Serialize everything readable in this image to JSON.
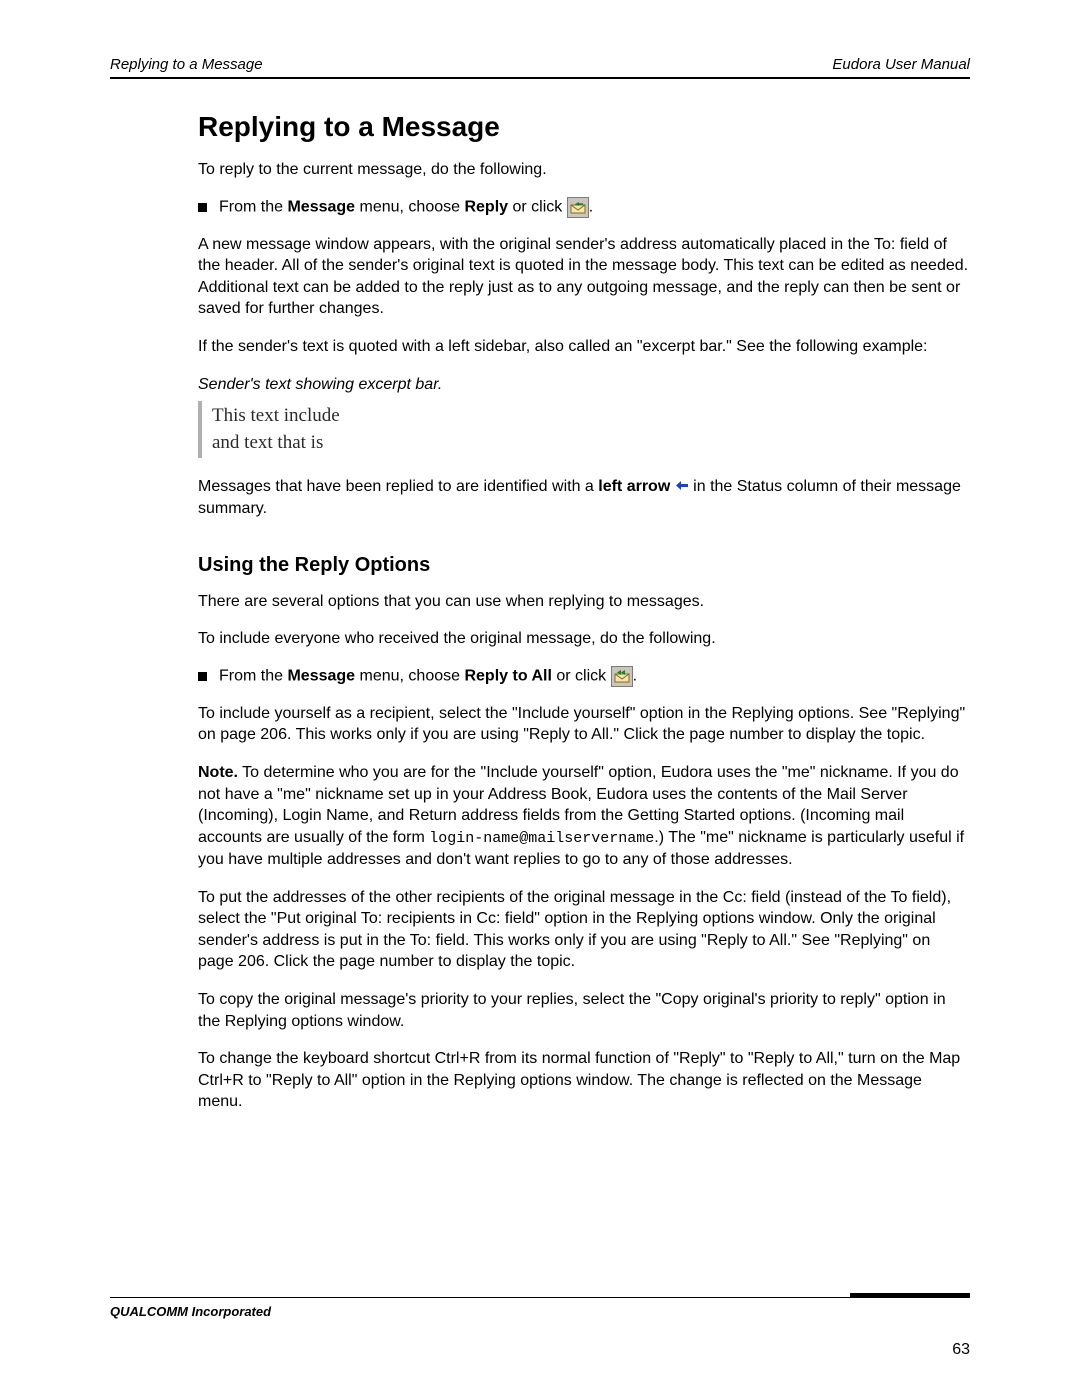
{
  "header": {
    "left": "Replying to a Message",
    "right": "Eudora User Manual"
  },
  "h1": "Replying to a Message",
  "p_intro": "To reply to the current message, do the following.",
  "bullet1": {
    "pre": "From the ",
    "bold1": "Message",
    "mid": " menu, choose ",
    "bold2": "Reply",
    "after": " or click ",
    "period": "."
  },
  "p2": "A new message window appears, with the original sender's address automatically placed in the To: field of the header. All of the sender's original text is quoted in the message body. This text can be edited as needed. Additional text can be added to the reply just as to any outgoing message, and the reply can then be sent or saved for further changes.",
  "p3": "If the sender's text is quoted with a left sidebar, also called an \"excerpt bar.\" See the following example:",
  "caption1": "Sender's text showing excerpt bar.",
  "excerpt": {
    "line1": "This text include",
    "line2": "and text that is"
  },
  "p4": {
    "pre": "Messages that have been replied to are identified with a ",
    "bold": "left arrow",
    "after": " in the Status column of their message summary."
  },
  "h2": "Using the Reply Options",
  "p5": "There are several options that you can use when replying to messages.",
  "p6": "To include everyone who received the original message, do the following.",
  "bullet2": {
    "pre": "From the ",
    "bold1": "Message",
    "mid": " menu, choose ",
    "bold2": "Reply to All",
    "after": " or click ",
    "period": "."
  },
  "p7": "To include yourself as a recipient, select the \"Include yourself\" option in the Replying options. See \"Replying\" on page 206. This works only if you are using \"Reply to All.\" Click the page number to display the topic.",
  "note": {
    "label": "Note.",
    "pre": " To determine who you are for the \"Include yourself\" option, Eudora uses the \"me\" nickname. If you do not have a \"me\" nickname set up in your Address Book, Eudora uses the contents of the Mail Server (Incoming), Login Name, and Return address fields from the Getting Started options. (Incoming mail accounts are usually of the form ",
    "code": "login-name@mailservername",
    "post": ".) The \"me\" nickname is particularly useful if you have multiple addresses and don't want replies to go to any of those addresses."
  },
  "p8": "To put the addresses of the other recipients of the original message in the Cc: field (instead of the To field), select the \"Put original To: recipients in Cc: field\" option in the Replying options window. Only the original sender's address is put in the To: field. This works only if you are using \"Reply to All.\" See \"Replying\" on page 206. Click the page number to display the topic.",
  "p9": "To copy the original message's priority to your replies, select the \"Copy original's priority to reply\" option in the Replying options window.",
  "p10": "To change the keyboard shortcut Ctrl+R from its normal function of \"Reply\" to \"Reply to All,\" turn on the Map Ctrl+R to \"Reply to All\" option in the Replying options window. The change is reflected on the Message menu.",
  "footer": "QUALCOMM Incorporated",
  "page_number": "63"
}
